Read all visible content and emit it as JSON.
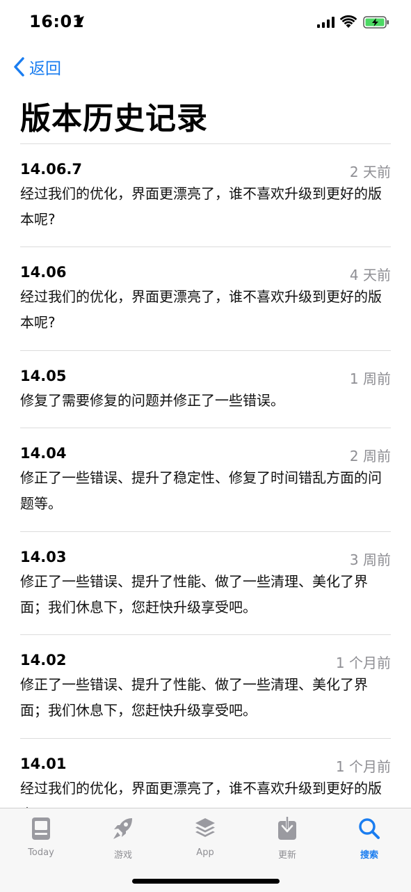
{
  "status": {
    "time": "16:01",
    "battery_color": "#4cd964"
  },
  "nav": {
    "back_label": "返回"
  },
  "page": {
    "title": "版本历史记录"
  },
  "versions": [
    {
      "version": "14.06.7",
      "ago": "2 天前",
      "notes": "经过我们的优化，界面更漂亮了，谁不喜欢升级到更好的版本呢?"
    },
    {
      "version": "14.06",
      "ago": "4 天前",
      "notes": "经过我们的优化，界面更漂亮了，谁不喜欢升级到更好的版本呢?"
    },
    {
      "version": "14.05",
      "ago": "1 周前",
      "notes": "修复了需要修复的问题并修正了一些错误。"
    },
    {
      "version": "14.04",
      "ago": "2 周前",
      "notes": "修正了一些错误、提升了稳定性、修复了时间错乱方面的问题等。"
    },
    {
      "version": "14.03",
      "ago": "3 周前",
      "notes": "修正了一些错误、提升了性能、做了一些清理、美化了界面；我们休息下，您赶快升级享受吧。"
    },
    {
      "version": "14.02",
      "ago": "1 个月前",
      "notes": "修正了一些错误、提升了性能、做了一些清理、美化了界面；我们休息下，您赶快升级享受吧。"
    },
    {
      "version": "14.01",
      "ago": "1 个月前",
      "notes": "经过我们的优化，界面更漂亮了，谁不喜欢升级到更好的版本呢?"
    }
  ],
  "tabbar": {
    "tabs": [
      {
        "label": "Today",
        "icon": "today-icon"
      },
      {
        "label": "游戏",
        "icon": "rocket-icon"
      },
      {
        "label": "App",
        "icon": "layers-icon"
      },
      {
        "label": "更新",
        "icon": "download-icon"
      },
      {
        "label": "搜索",
        "icon": "search-icon",
        "active": true
      }
    ],
    "active_color": "#1a7df0",
    "inactive_color": "#8e8e93"
  }
}
